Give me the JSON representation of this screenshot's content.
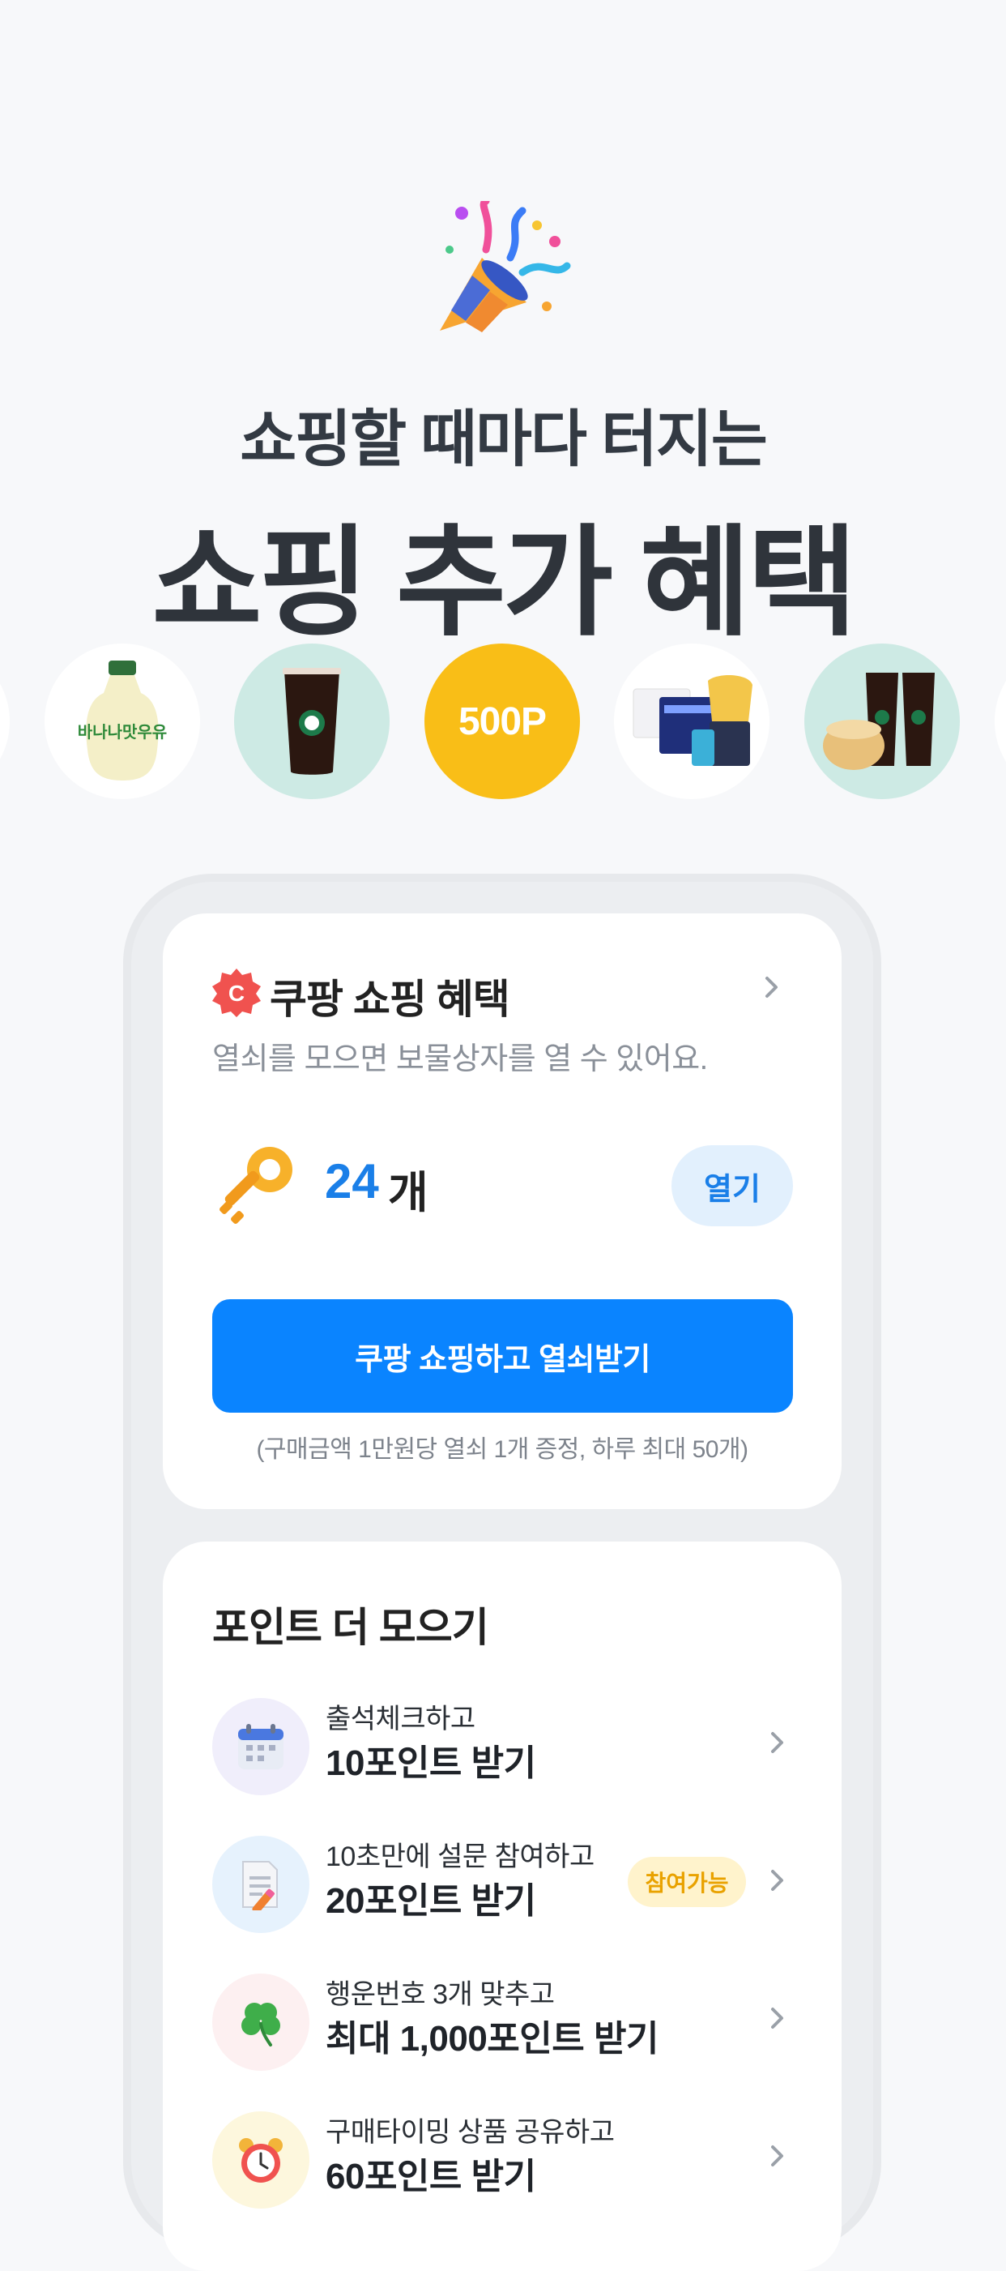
{
  "hero": {
    "subtitle": "쇼핑할 때마다 터지는",
    "title": "쇼핑 추가 혜택"
  },
  "carousel": {
    "items": [
      {
        "name": "banana-milk",
        "label": "바나나맛우유"
      },
      {
        "name": "iced-americano",
        "label": ""
      },
      {
        "name": "points",
        "label": "500P"
      },
      {
        "name": "movie-tickets",
        "label": ""
      },
      {
        "name": "coffee-cake-set",
        "label": ""
      }
    ]
  },
  "benefit_card": {
    "badge_letter": "C",
    "title": "쿠팡 쇼핑 혜택",
    "description": "열쇠를 모으면 보물상자를 열 수 있어요.",
    "key_count": "24",
    "key_unit": "개",
    "open_label": "열기",
    "cta_label": "쿠팡 쇼핑하고 열쇠받기",
    "cta_note": "(구매금액 1만원당 열쇠 1개 증정, 하루 최대 50개)"
  },
  "points_card": {
    "title": "포인트 더 모으기",
    "tasks": [
      {
        "line1": "출석체크하고",
        "line2": "10포인트 받기",
        "badge": "",
        "icon": "calendar-icon"
      },
      {
        "line1": "10초만에 설문 참여하고",
        "line2": "20포인트 받기",
        "badge": "참여가능",
        "icon": "survey-icon"
      },
      {
        "line1": "행운번호 3개 맞추고",
        "line2": "최대 1,000포인트 받기",
        "badge": "",
        "icon": "clover-icon"
      },
      {
        "line1": "구매타이밍 상품 공유하고",
        "line2": "60포인트 받기",
        "badge": "",
        "icon": "alarm-clock-icon"
      }
    ]
  },
  "colors": {
    "accent": "#0a84ff",
    "points_yellow": "#f9be17",
    "badge_red": "#f0524f"
  }
}
